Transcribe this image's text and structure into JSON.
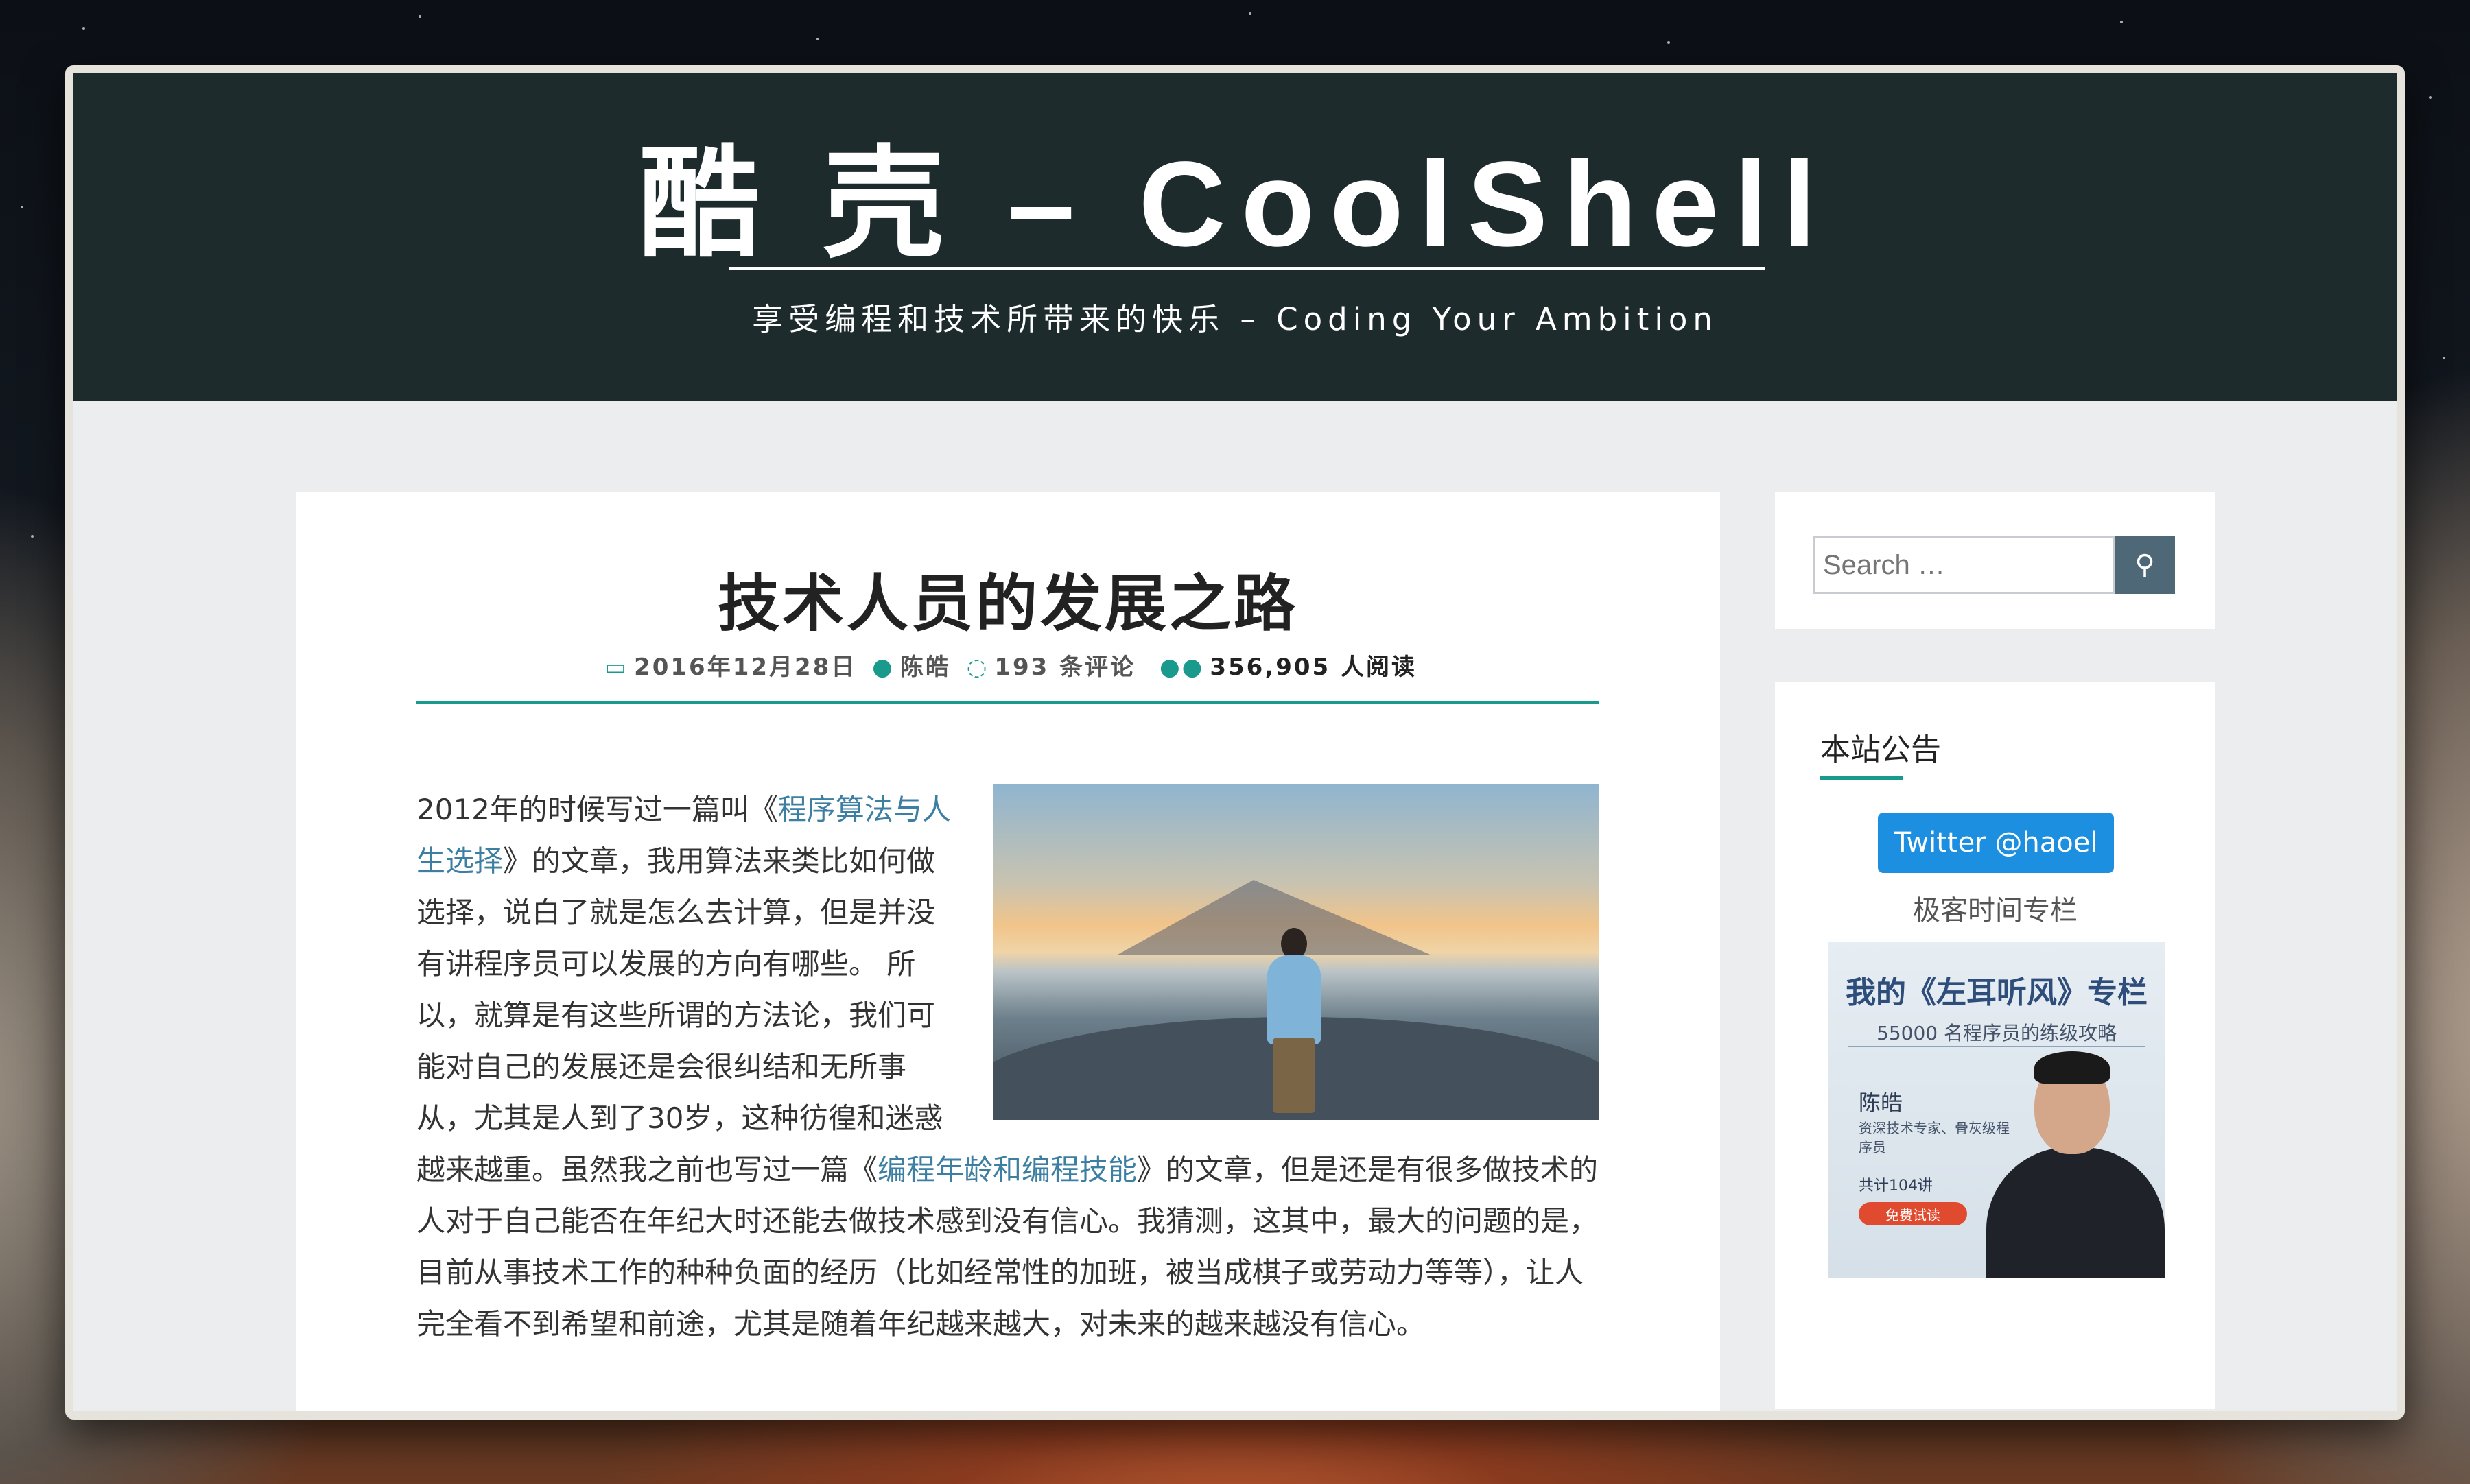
{
  "site": {
    "title": "酷 壳 – CoolShell",
    "tagline": "享受编程和技术所带来的快乐 – Coding Your Ambition"
  },
  "post": {
    "title": "技术人员的发展之路",
    "meta": {
      "date": "2016年12月28日",
      "author": "陈皓",
      "comments": "193 条评论",
      "reads": "356,905 人阅读"
    },
    "para1_a": "2012年的时候写过一篇叫《",
    "link1": "程序算法与人生选择",
    "para1_b": "》的文章，我用算法来类比如何做选择，说白了就是怎么去计算，但是并没有讲程序员可以发展的方向有哪些。 所以，就算是有这些所谓的方法论，我们可能对自己的发展还是会很纠结和无所事从，尤其是人到了30岁，这种彷徨和迷惑越来越重。虽然我之前也写过一篇《",
    "link2": "编程年龄和编程技能",
    "para1_c": "》的文章，但是还是有很多做技术的人对于自己能否在年纪大时还能去做技术感到没有信心。我猜测，这其中，最大的问题的是，目前从事技术工作的种种负面的经历（比如经常性的加班，被当成棋子或劳动力等等），让人完全看不到希望和前途，尤其是随着年纪越来越大，对未来的越来越没有信心。"
  },
  "sidebar": {
    "search": {
      "placeholder": "Search …"
    },
    "notice": {
      "title": "本站公告",
      "twitter": "Twitter @haoel",
      "column_label": "极客时间专栏",
      "promo": {
        "title": "我的《左耳听风》专栏",
        "subtitle": "55000 名程序员的练级攻略",
        "name": "陈皓",
        "desc": "资深技术专家、骨灰级程序员",
        "count": "共计104讲",
        "trial": "免费试读"
      }
    }
  },
  "colors": {
    "header_bg": "#1e2b2c",
    "accent": "#1a9a8c",
    "link": "#3d7fa3",
    "twitter": "#1d8fe0"
  },
  "icons": [
    "calendar-icon",
    "user-icon",
    "comments-icon",
    "users-icon",
    "search-icon"
  ]
}
